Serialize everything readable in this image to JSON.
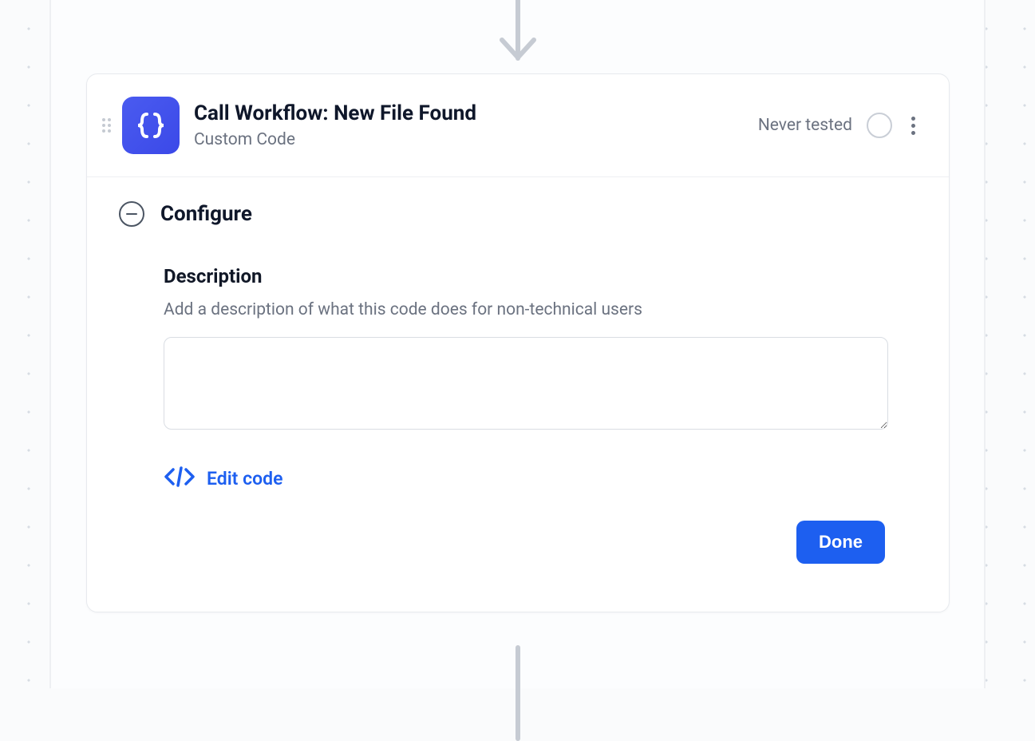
{
  "step": {
    "title": "Call Workflow: New File Found",
    "subtitle": "Custom Code",
    "status_text": "Never tested"
  },
  "section": {
    "title": "Configure"
  },
  "description": {
    "label": "Description",
    "help": "Add a description of what this code does for non-technical users",
    "value": ""
  },
  "actions": {
    "edit_code": "Edit code",
    "done": "Done"
  }
}
